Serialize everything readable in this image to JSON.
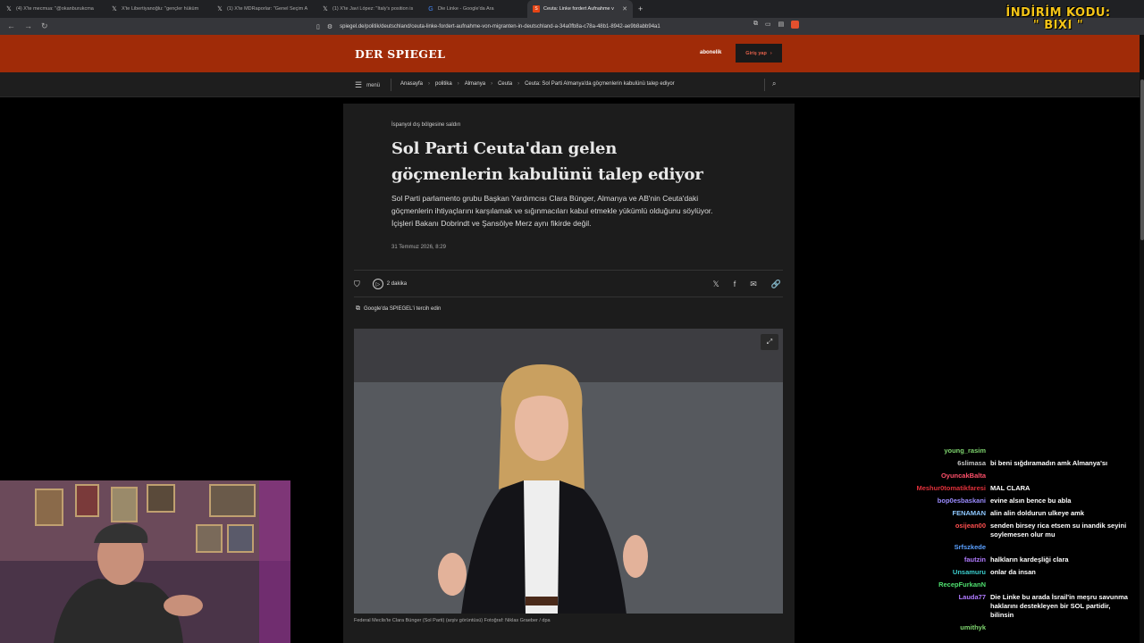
{
  "tabs": [
    {
      "title": "(4) X'te mecmua: \"@okanburukcma",
      "icon": "x-icon"
    },
    {
      "title": "X'te Libertiyanoğlu: \"gençler hüküm",
      "icon": "x-icon"
    },
    {
      "title": "(1) X'te MDRaporlar: \"Genel Seçim A",
      "icon": "x-icon"
    },
    {
      "title": "(1) X'te Javi López: \"Italy's position is",
      "icon": "x-icon"
    },
    {
      "title": "Die Linke - Google'da Ara",
      "icon": "google-icon"
    },
    {
      "title": "Ceuta: Linke fordert Aufnahme v",
      "icon": "spiegel-icon",
      "active": true
    }
  ],
  "url": "spiegel.de/politik/deutschland/ceuta-linke-fordert-aufnahme-von-migranten-in-deutschland-a-34a0fb8a-c78a-48b1-8942-ae9b8abb94a1",
  "promo": {
    "line1": "İNDİRİM KODU:",
    "line2": "\" BIXI \""
  },
  "header": {
    "logo": "DER SPIEGEL",
    "subscribe": "abonelik",
    "login": "Giriş yap"
  },
  "subnav": {
    "menu": "menü",
    "crumbs": [
      "Anasayfa",
      "politika",
      "Almanya",
      "Ceuta",
      "Ceuta: Sol Parti Almanya'da göçmenlerin kabulünü talep ediyor"
    ]
  },
  "article": {
    "kicker": "İspanyol dış bölgesine saldırı",
    "headline": "Sol Parti Ceuta'dan gelen göçmenlerin kabulünü talep ediyor",
    "lead": "Sol Parti parlamento grubu Başkan Yardımcısı Clara Bünger, Almanya ve AB'nin Ceuta'daki göçmenlerin ihtiyaçlarını karşılamak ve sığınmacıları kabul etmekle yükümlü olduğunu söylüyor. İçişleri Bakanı Dobrindt ve Şansölye Merz aynı fikirde değil.",
    "date": "31 Temmuz 2026, 8:29",
    "read_time": "2 dakika",
    "google_pref": "Google'da SPIEGEL'i tercih edin",
    "caption": "Federal Meclis'te Clara Bünger (Sol Parti) (arşiv görüntüsü)  Fotoğraf: Niklas Graeber / dpa"
  },
  "chat": [
    {
      "user": "young_rasim",
      "text": "",
      "color": "#7fd66f"
    },
    {
      "user": "6slimasa",
      "text": "bi beni sığdıramadın amk Almanya'sı",
      "color": "#c8c8c8"
    },
    {
      "user": "OyuncakBalta",
      "text": "",
      "color": "#ff4f6a"
    },
    {
      "user": "Meshur0tomatikfaresi",
      "text": "MAL CLARA",
      "color": "#e0303a"
    },
    {
      "user": "bop0esbaskani",
      "text": "evine alsın bence bu abla",
      "color": "#9b8cff"
    },
    {
      "user": "FENAMAN",
      "text": "alin alin doldurun ulkeye amk",
      "color": "#8ec8ff"
    },
    {
      "user": "osijean00",
      "text": "senden birsey rica etsem su inandik seyini soylemesen olur mu",
      "color": "#ff4f4f"
    },
    {
      "user": "Srfszkede",
      "text": "",
      "color": "#5aa0ff"
    },
    {
      "user": "fautzin",
      "text": "halkların kardeşliği clara",
      "color": "#b07bff"
    },
    {
      "user": "Unsamuru",
      "text": "onlar da insan",
      "color": "#3ccfcf"
    },
    {
      "user": "RecepFurkanN",
      "text": "",
      "color": "#4fe06f"
    },
    {
      "user": "Lauda77",
      "text": "Die Linke bu arada İsrail'in meşru savunma haklarını destekleyen bir SOL partidir, bilinsin",
      "color": "#b07bff"
    },
    {
      "user": "umithyk",
      "text": "",
      "color": "#7fd66f"
    }
  ]
}
